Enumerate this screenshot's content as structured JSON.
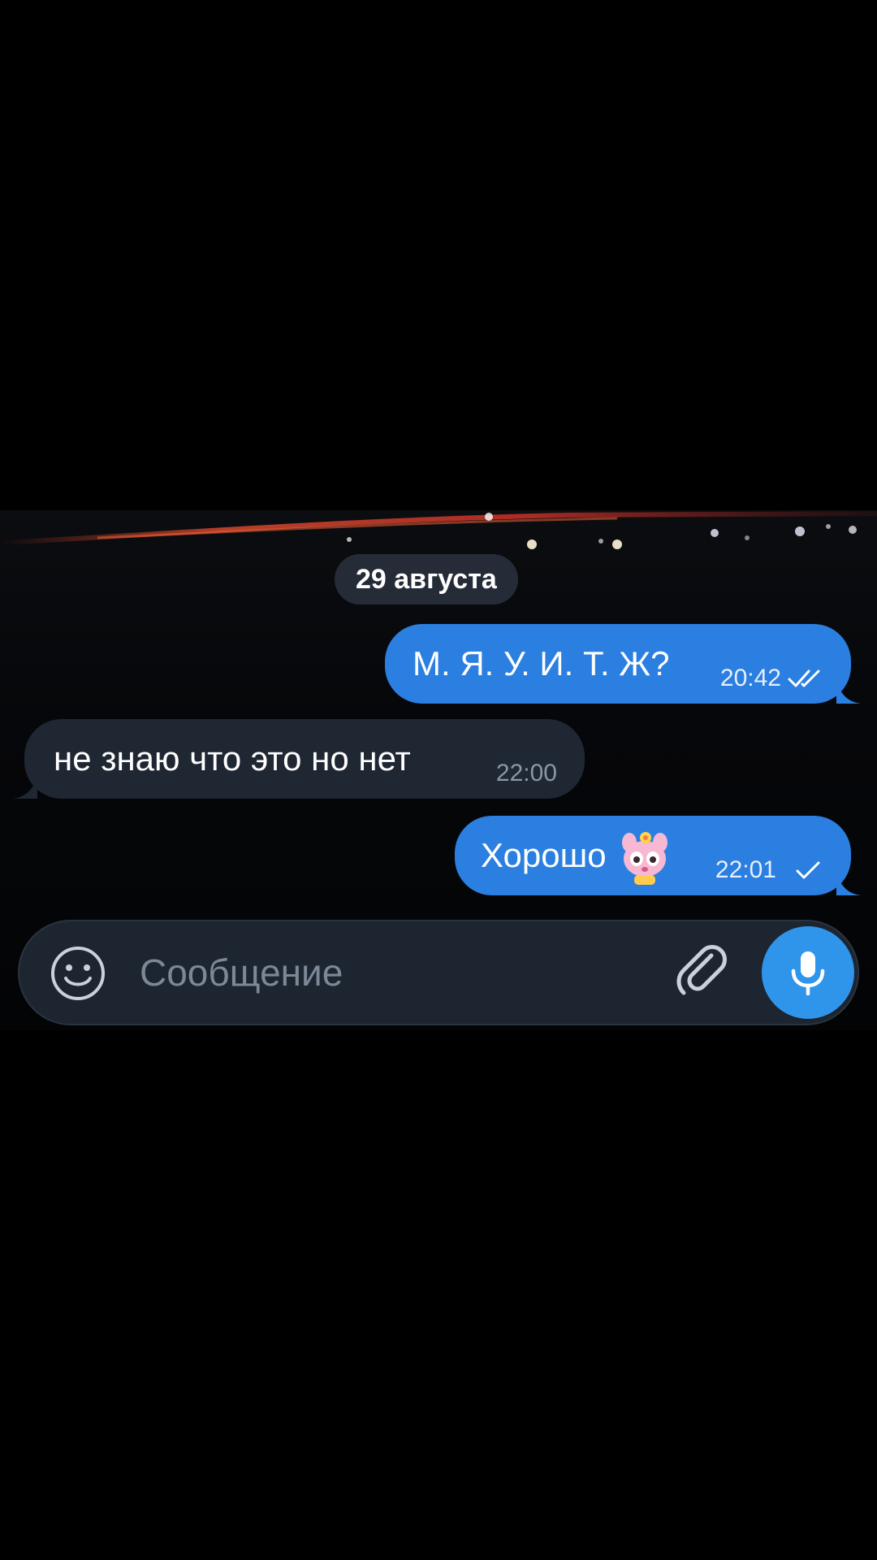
{
  "chat": {
    "date_separator": "29 августа",
    "messages": [
      {
        "direction": "outgoing",
        "text": "М. Я. У. И. Т. Ж?",
        "time": "20:42",
        "status": "read"
      },
      {
        "direction": "incoming",
        "text": "не знаю что это но нет",
        "time": "22:00"
      },
      {
        "direction": "outgoing",
        "text": "Хорошо",
        "emoji": "pink-bunny-sticker-icon",
        "time": "22:01",
        "status": "sent"
      }
    ]
  },
  "composer": {
    "placeholder": "Сообщение",
    "icons": {
      "emoji": "smiley-icon",
      "attach": "paperclip-icon",
      "voice": "microphone-icon"
    }
  },
  "colors": {
    "outgoing_bubble": "#2b7fe0",
    "incoming_bubble": "#1f2733",
    "accent": "#2f95ea",
    "background": "#000000"
  }
}
